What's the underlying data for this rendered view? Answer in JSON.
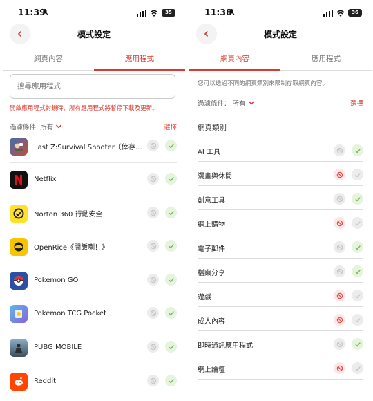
{
  "left": {
    "status": {
      "time": "11:39",
      "battery": "35"
    },
    "nav": {
      "title": "模式設定"
    },
    "tabs": [
      "網頁內容",
      "應用程式"
    ],
    "search": {
      "placeholder": "搜尋應用程式"
    },
    "warning": "開啟應用程式封鎖時，所有應用程式將暫停下載及更新。",
    "filter": {
      "label": "過濾條件: 所有",
      "select": "選擇"
    },
    "apps": [
      {
        "name": "Last Z:Survival Shooter（倖存者...",
        "status": "allow"
      },
      {
        "name": "Netflix",
        "status": "allow"
      },
      {
        "name": "Norton 360 行動安全",
        "status": "allow"
      },
      {
        "name": "OpenRice《開飯喇！》",
        "status": "allow"
      },
      {
        "name": "Pokémon GO",
        "status": "allow"
      },
      {
        "name": "Pokémon TCG Pocket",
        "status": "allow"
      },
      {
        "name": "PUBG MOBILE",
        "status": "allow"
      },
      {
        "name": "Reddit",
        "status": "allow"
      }
    ]
  },
  "right": {
    "status": {
      "time": "11:38",
      "battery": "36"
    },
    "nav": {
      "title": "模式設定"
    },
    "tabs": [
      "網頁內容",
      "應用程式"
    ],
    "description": "您可以透過不同的網頁類別來限制存取網頁內容。",
    "filter": {
      "label": "過濾條件： 所有",
      "select": "選擇"
    },
    "category_header": "網頁類別",
    "categories": [
      {
        "name": "AI 工具",
        "status": "allow"
      },
      {
        "name": "漫畫與休閒",
        "status": "block"
      },
      {
        "name": "創意工具",
        "status": "allow"
      },
      {
        "name": "網上購物",
        "status": "block"
      },
      {
        "name": "電子郵件",
        "status": "allow"
      },
      {
        "name": "檔案分享",
        "status": "allow"
      },
      {
        "name": "遊戲",
        "status": "block"
      },
      {
        "name": "成人內容",
        "status": "block"
      },
      {
        "name": "即時通訊應用程式",
        "status": "allow"
      },
      {
        "name": "網上論壇",
        "status": "block"
      }
    ]
  },
  "colors": {
    "accent": "#d63b2f",
    "allow": "#79b85a",
    "block": "#e05050",
    "neutral": "#c8c8c8"
  }
}
